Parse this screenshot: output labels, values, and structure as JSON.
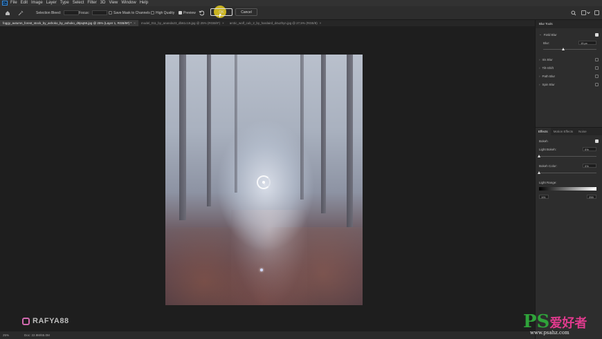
{
  "menu": {
    "logo": "Ps",
    "items": [
      "File",
      "Edit",
      "Image",
      "Layer",
      "Type",
      "Select",
      "Filter",
      "3D",
      "View",
      "Window",
      "Help"
    ]
  },
  "options": {
    "selection_bleed": "Selection Bleed:",
    "focus": "Focus:",
    "save_mask": "Save Mask to Channels",
    "high_quality": "High Quality",
    "preview": "Preview",
    "ok": "OK",
    "cancel": "Cancel"
  },
  "tabs": [
    {
      "label": "foggy_autumn_forest_stock_by_ashoko_by_ashoko_d9jsq56.jpg @ 25% (Layer 1, RGB/8#) *",
      "active": true
    },
    {
      "label": "model_011_by_ananda23_db61c19.jpg @ 25% (RGB/8*)",
      "active": false
    },
    {
      "label": "arctic_wolf_cub_2_by_hardaird_d4u2hyn.jpg @ 27,5% (RGB/8)",
      "active": false
    }
  ],
  "canvas": {
    "blur_value": "0"
  },
  "watermark": "RAFYA88",
  "status": {
    "zoom": "25%",
    "doc": "Doc: 22.9M/65.0M"
  },
  "blur_tools": {
    "title": "Blur Tools",
    "field_blur": {
      "label": "Field Blur",
      "checked": true,
      "blur_label": "Blur:",
      "blur_value": "15 px",
      "blur_level": 0.38
    },
    "others": [
      {
        "label": "Iris Blur"
      },
      {
        "label": "Tilt-Shift"
      },
      {
        "label": "Path Blur"
      },
      {
        "label": "Spin Blur"
      }
    ]
  },
  "effects": {
    "tabs": [
      "Effects",
      "Motion Effects",
      "Noise"
    ],
    "bokeh": "Bokeh",
    "light_bokeh": {
      "label": "Light Bokeh:",
      "value": "0%"
    },
    "bokeh_color": {
      "label": "Bokeh Color:",
      "value": "0%"
    },
    "light_range": {
      "label": "Light Range:",
      "min": "191",
      "max": "255"
    }
  },
  "brand": {
    "ps": "PS",
    "cn": "爱好者",
    "url": "www.psahz.com"
  }
}
